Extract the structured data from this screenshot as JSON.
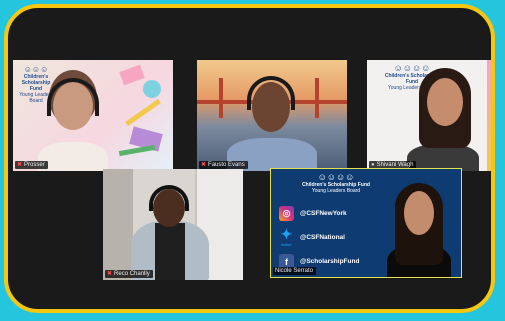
{
  "tiles": [
    {
      "name": "Prosser",
      "muted": true
    },
    {
      "name": "Fausto Evans",
      "muted": true
    },
    {
      "name": "Shivani Wagh",
      "muted": false
    },
    {
      "name": "Reco Chanlly",
      "muted": true
    },
    {
      "name": "Nicole Serrato",
      "muted": false
    }
  ],
  "logos": {
    "left": {
      "line1": "Children's Scholarship Fund",
      "line2": "Young Leaders Board"
    },
    "right": {
      "line1": "Children's Scholarship Fund",
      "line2": "Young Leaders Board"
    },
    "banner": {
      "line1": "Children's Scholarship Fund",
      "line2": "Young Leaders Board"
    }
  },
  "socials": [
    {
      "icon": "instagram-icon",
      "handle": "@CSFNewYork",
      "color": "#d6307a"
    },
    {
      "icon": "twitter-icon",
      "handle": "@CSFNational",
      "color": "#1da1f2",
      "caption": "twitter"
    },
    {
      "icon": "facebook-icon",
      "handle": "@ScholarshipFund",
      "color": "#3b5998"
    }
  ],
  "colors": {
    "background": "#25c6dd",
    "frame_border": "#f7c70f",
    "frame_fill": "#1a1a1a",
    "banner": "#0e3b72"
  }
}
